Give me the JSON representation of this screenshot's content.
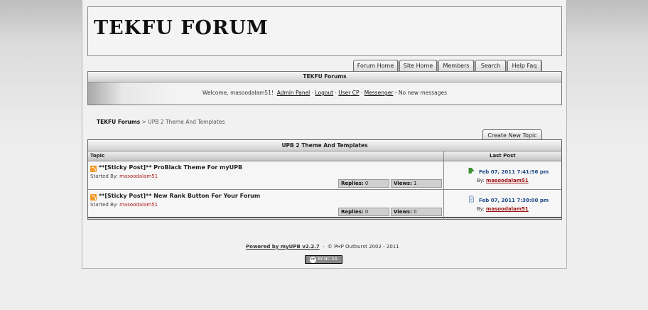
{
  "header": {
    "logo_text": "TEKFU FORUM"
  },
  "tabs": [
    "Forum Home",
    "Site Home",
    "Members",
    "Search",
    "Help Faq"
  ],
  "navbox": {
    "title": "TEKFU Forums",
    "welcome": "Welcome, masoodalam51!",
    "links": [
      "Admin Panel",
      "Logout",
      "User CP",
      "Messenger"
    ],
    "messages": "No new messages"
  },
  "breadcrumb": {
    "root": "TEKFU Forums",
    "separator": ">",
    "current": "UPB 2 Theme And Templates"
  },
  "new_topic_label": "Create New Topic",
  "forum": {
    "title": "UPB 2 Theme And Templates",
    "col_topic": "Topic",
    "col_lastpost": "Last Post",
    "topics": [
      {
        "title": "**[Sticky Post]** ProBlack Theme For myUPB",
        "started_label": "Started By:",
        "author": "masoodalam51",
        "replies_label": "Replies:",
        "replies": "0",
        "views_label": "Views:",
        "views": "1",
        "last_date": "Feb 07, 2011 7:41:56 pm",
        "by_label": "By:",
        "last_user": "masoodalam51",
        "icon": "new-post-arrow-icon"
      },
      {
        "title": "**[Sticky Post]** New Rank Button For Your Forum",
        "started_label": "Started By:",
        "author": "masoodalam51",
        "replies_label": "Replies:",
        "replies": "0",
        "views_label": "Views:",
        "views": "0",
        "last_date": "Feb 07, 2011 7:38:00 pm",
        "by_label": "By:",
        "last_user": "masoodalam51",
        "icon": "document-icon"
      }
    ]
  },
  "footer": {
    "powered": "Powered by myUPB v2.2.7",
    "copyright": "© PHP Outburst 2002 - 2011",
    "license": "BY-NC-SA",
    "cc_mark": "cc"
  }
}
